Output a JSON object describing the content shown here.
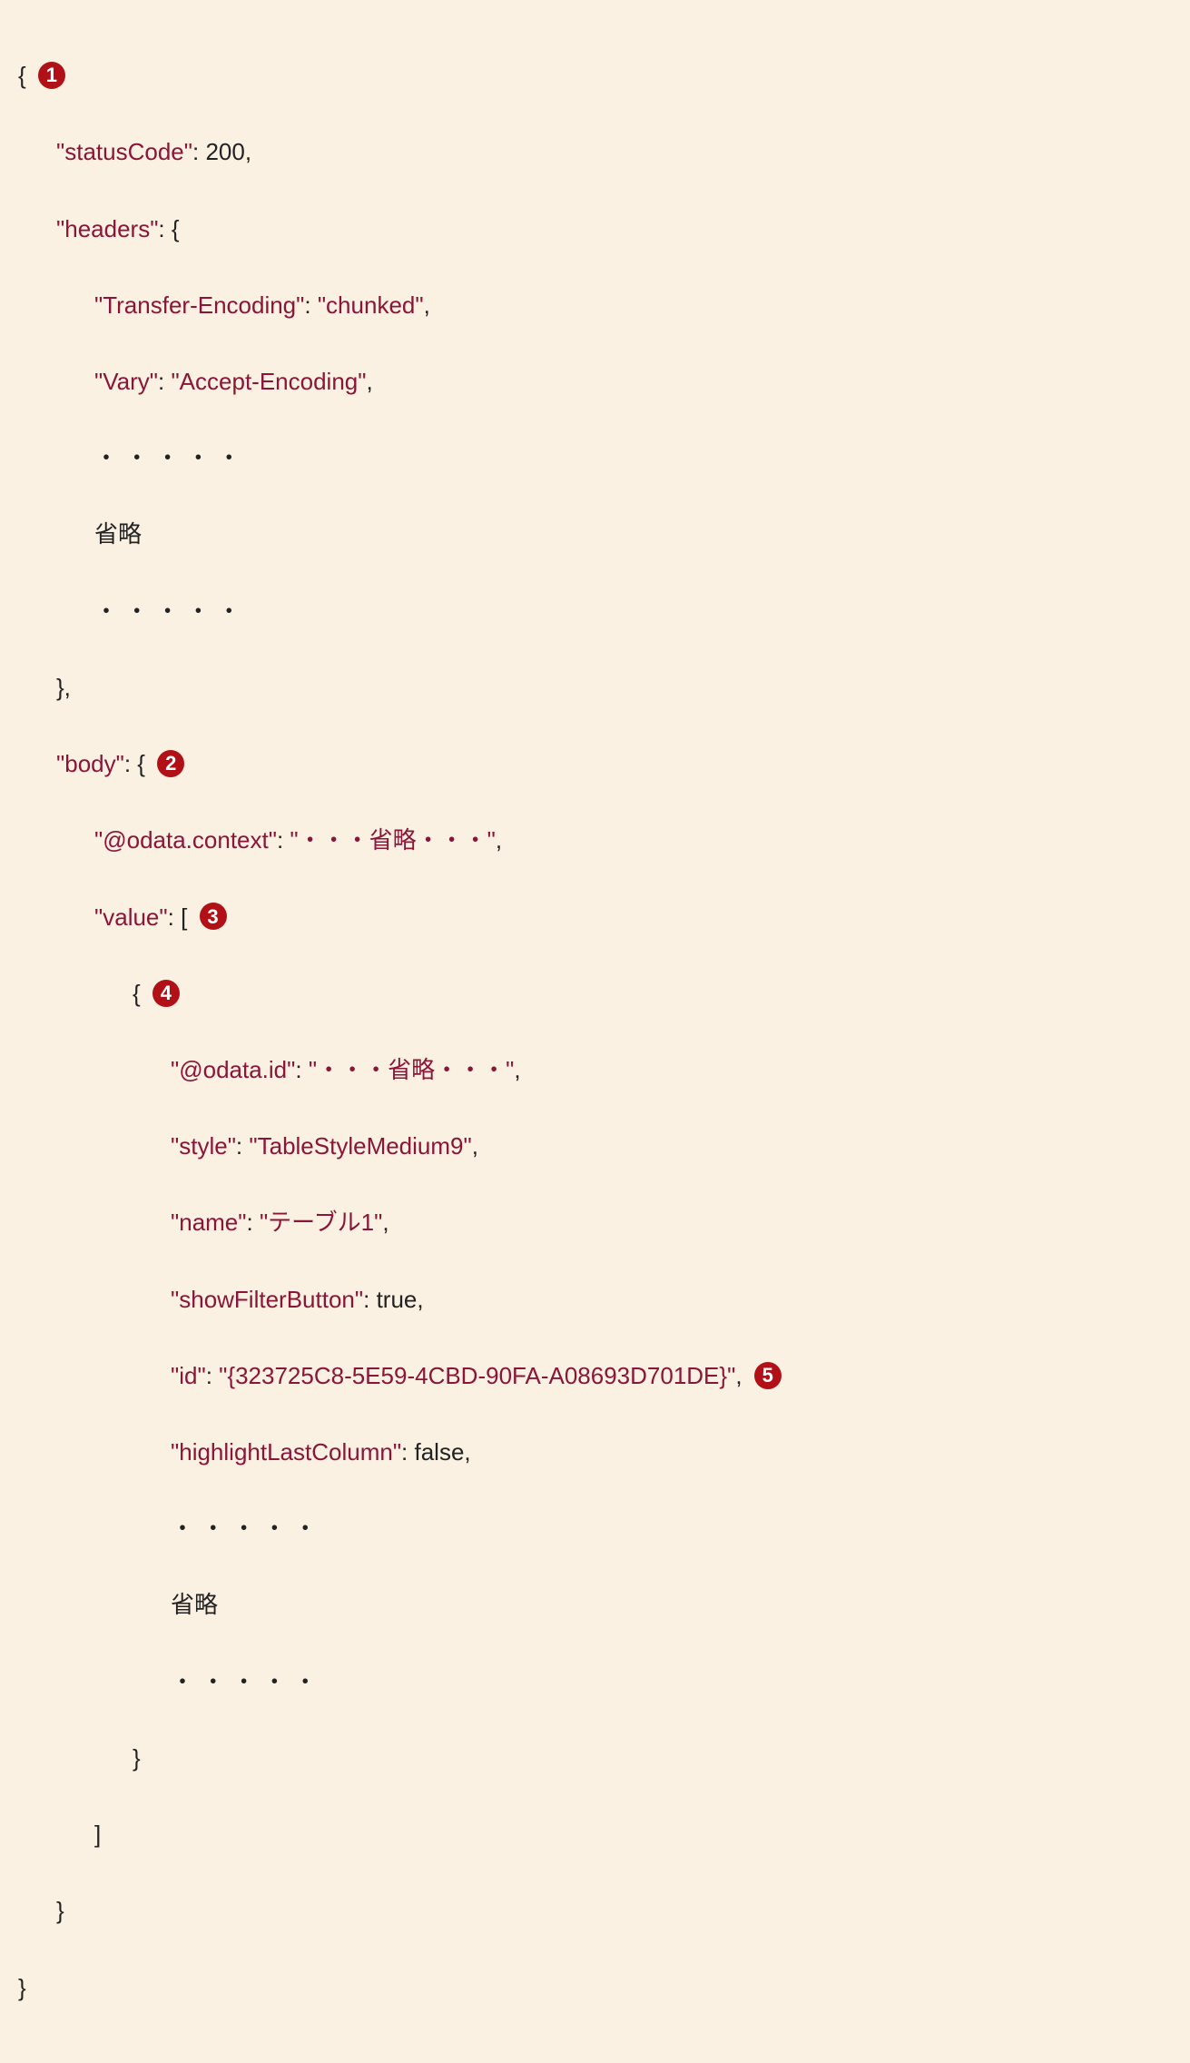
{
  "badges": {
    "b1": "1",
    "b2": "2",
    "b3": "3",
    "b4": "4",
    "b5": "5"
  },
  "code": {
    "l1_open": "{",
    "statusCode_k": "\"statusCode\"",
    "statusCode_v": "200",
    "headers_k": "\"headers\"",
    "transferEncoding_k": "\"Transfer-Encoding\"",
    "transferEncoding_v": "\"chunked\"",
    "vary_k": "\"Vary\"",
    "vary_v": "\"Accept-Encoding\"",
    "dots": "・・・・・",
    "omit": "省略",
    "body_k": "\"body\"",
    "odataContext_k": "\"@odata.context\"",
    "odataContext_v": "\"・・・省略・・・\"",
    "value_k": "\"value\"",
    "odataId_k": "\"@odata.id\"",
    "odataId_v": "\"・・・省略・・・\"",
    "style_k": "\"style\"",
    "style_v": "\"TableStyleMedium9\"",
    "name_k": "\"name\"",
    "name_v": "\"テーブル1\"",
    "showFilterButton_k": "\"showFilterButton\"",
    "showFilterButton_v": "true",
    "id_k": "\"id\"",
    "id_v": "\"{323725C8-5E59-4CBD-90FA-A08693D701DE}\"",
    "highlightLastColumn_k": "\"highlightLastColumn\"",
    "highlightLastColumn_v": "false",
    "closeBrace": "}",
    "closeBracket": "]",
    "colon": ": ",
    "comma": ",",
    "openBrace": "{",
    "openBracket": "[",
    "braceComma": "},"
  }
}
